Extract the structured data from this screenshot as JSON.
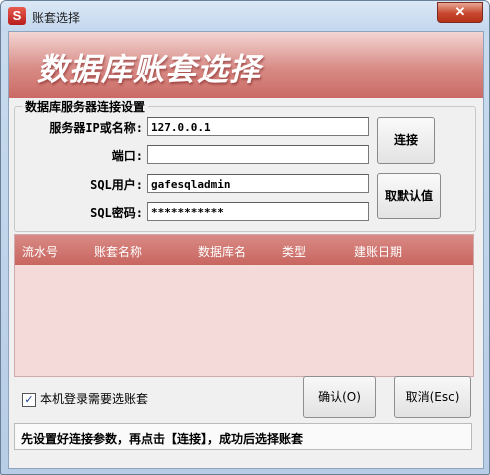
{
  "window": {
    "title": "账套选择",
    "app_icon_glyph": "S",
    "close_glyph": "✕"
  },
  "banner": {
    "title": "数据库账套选择"
  },
  "server_group": {
    "legend": "数据库服务器连接设置",
    "ip_label": "服务器IP或名称:",
    "ip_value": "127.0.0.1",
    "port_label": "端口:",
    "port_value": "",
    "user_label": "SQL用户:",
    "user_value": "gafesqladmin",
    "password_label": "SQL密码:",
    "password_value": "***********",
    "connect_button": "连接",
    "default_button": "取默认值"
  },
  "account_table": {
    "columns": [
      "流水号",
      "账套名称",
      "数据库名",
      "类型",
      "建账日期"
    ],
    "rows": []
  },
  "footer": {
    "checkbox_label": "本机登录需要选账套",
    "checkbox_checked": true,
    "checkbox_glyph": "✓",
    "confirm_button": "确认(O)",
    "cancel_button": "取消(Esc)",
    "status_text": "先设置好连接参数，再点击【连接】，成功后选择账套"
  },
  "colors": {
    "banner_gradient_top": "#f3d6d3",
    "banner_gradient_bottom": "#cb6a64",
    "grid_header": "#c96660",
    "grid_body": "#f5dada"
  }
}
